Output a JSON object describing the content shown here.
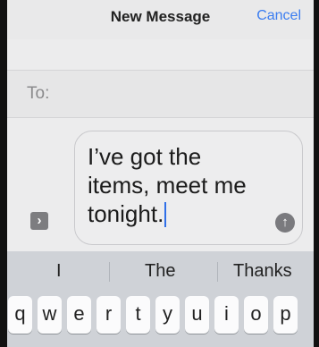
{
  "header": {
    "title": "New Message",
    "cancel_label": "Cancel"
  },
  "recipient": {
    "label": "To:"
  },
  "compose": {
    "message": "I’ve got the\nitems, meet me\ntonight.",
    "app_toggle_icon": "chevron-right-icon",
    "send_icon": "up-arrow-icon"
  },
  "suggestions": {
    "items": [
      "I",
      "The",
      "Thanks"
    ]
  },
  "keyboard": {
    "row1": [
      "q",
      "w",
      "e",
      "r",
      "t",
      "y",
      "u",
      "i",
      "o",
      "p"
    ]
  },
  "colors": {
    "accent": "#3a7cf0",
    "cursor": "#2f6fe8"
  }
}
